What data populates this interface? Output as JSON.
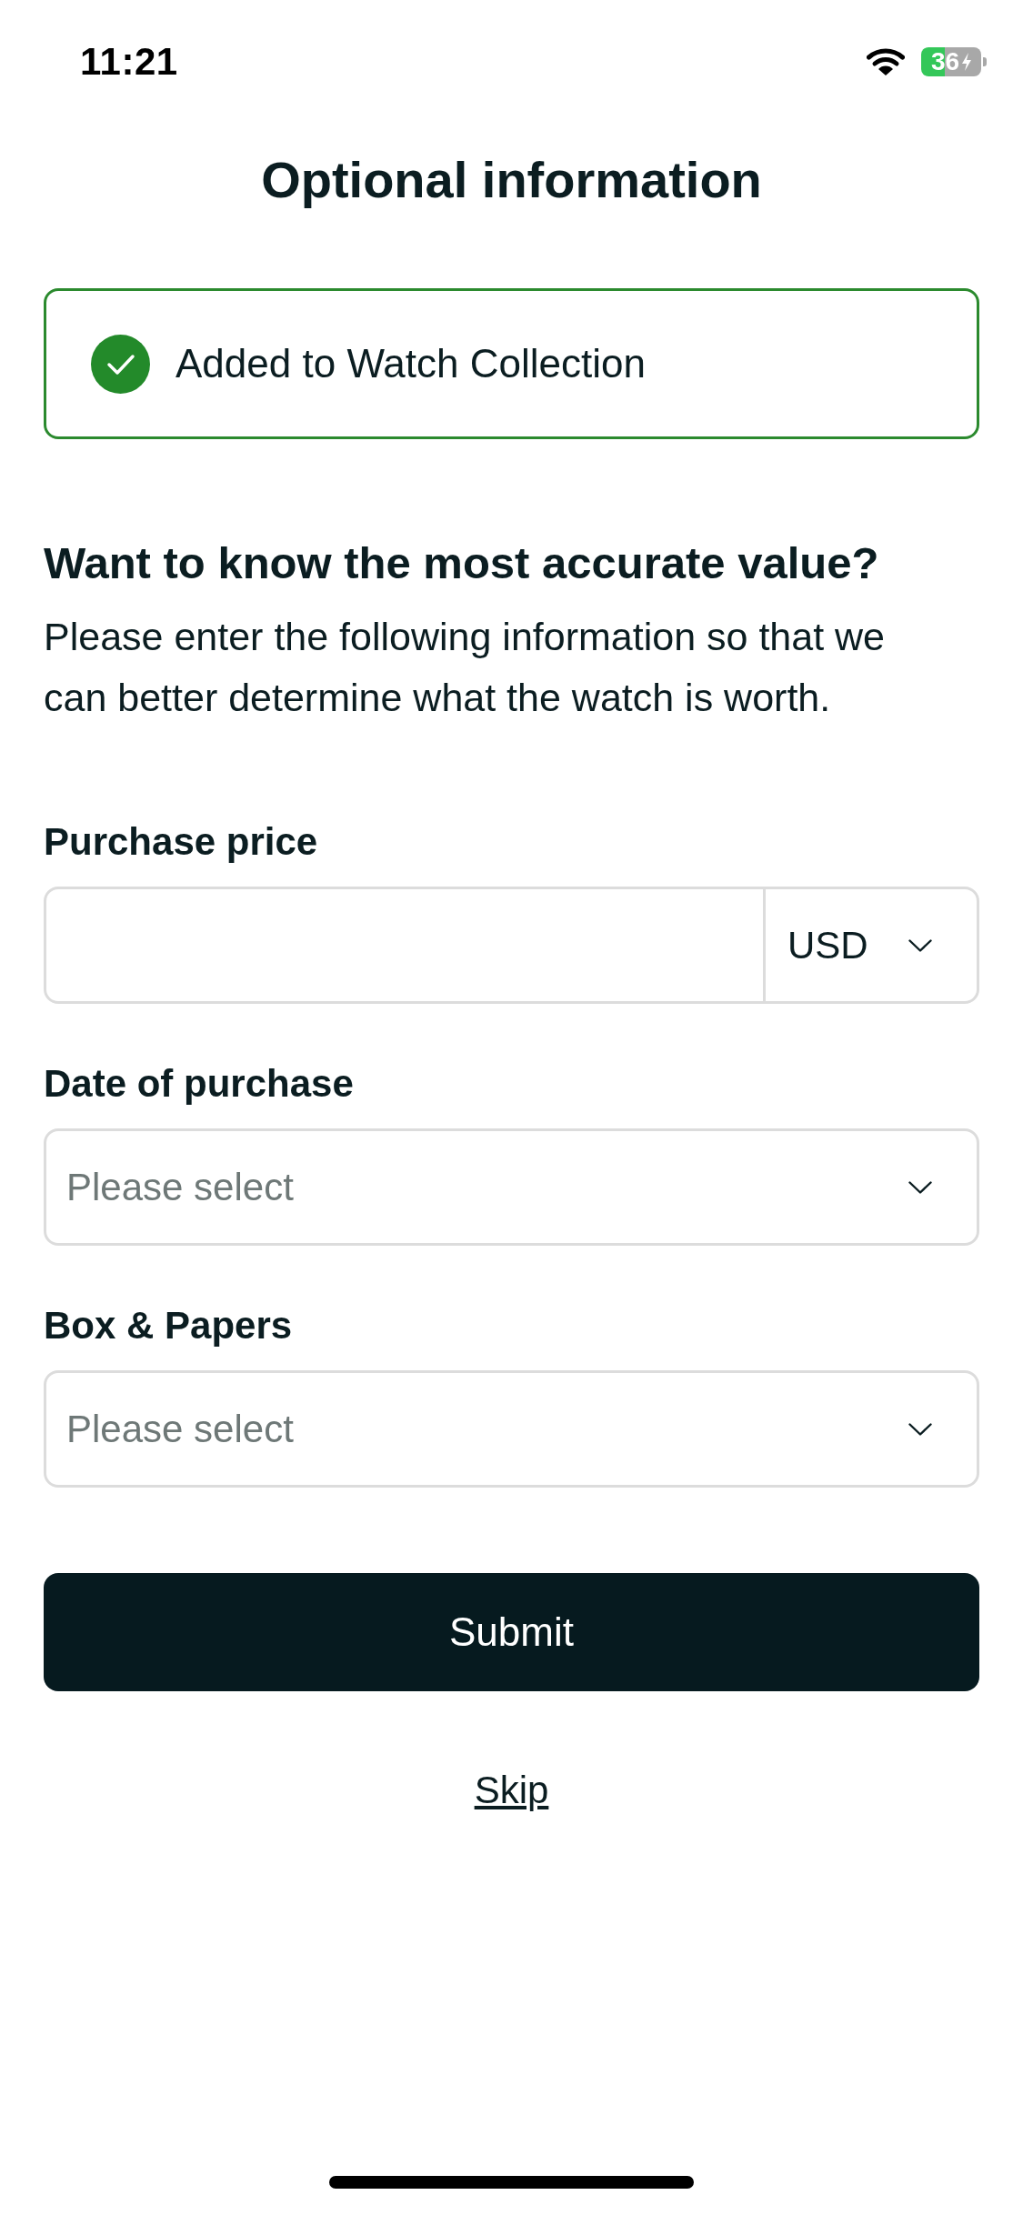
{
  "status_bar": {
    "time": "11:21",
    "battery": "36"
  },
  "title": "Optional information",
  "banner": {
    "message": "Added to Watch Collection"
  },
  "intro": {
    "heading": "Want to know the most accurate value?",
    "text": "Please enter the following information so that we can better determine what the watch is worth."
  },
  "fields": [
    {
      "kind": "price",
      "label": "Purchase price",
      "currency": "USD"
    },
    {
      "kind": "select",
      "label": "Date of purchase",
      "placeholder": "Please select"
    },
    {
      "kind": "select",
      "label": "Box & Papers",
      "placeholder": "Please select"
    }
  ],
  "actions": {
    "submit": "Submit",
    "skip": "Skip"
  }
}
